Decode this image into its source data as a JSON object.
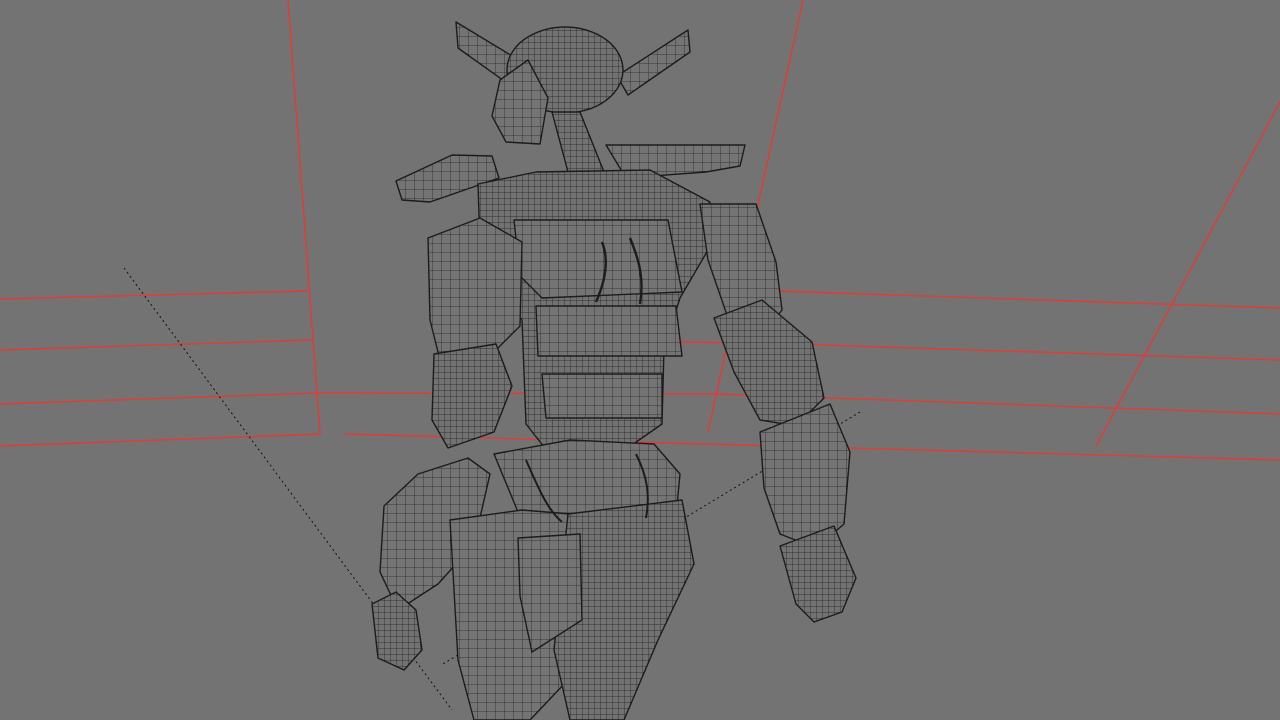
{
  "scene": {
    "background_color": "#737373",
    "room_line_color": "#e53935",
    "wire_color": "#1c1c1c",
    "guide_line_color": "#111111",
    "subject": "robot-wireframe",
    "view": "wireframe-viewport"
  }
}
